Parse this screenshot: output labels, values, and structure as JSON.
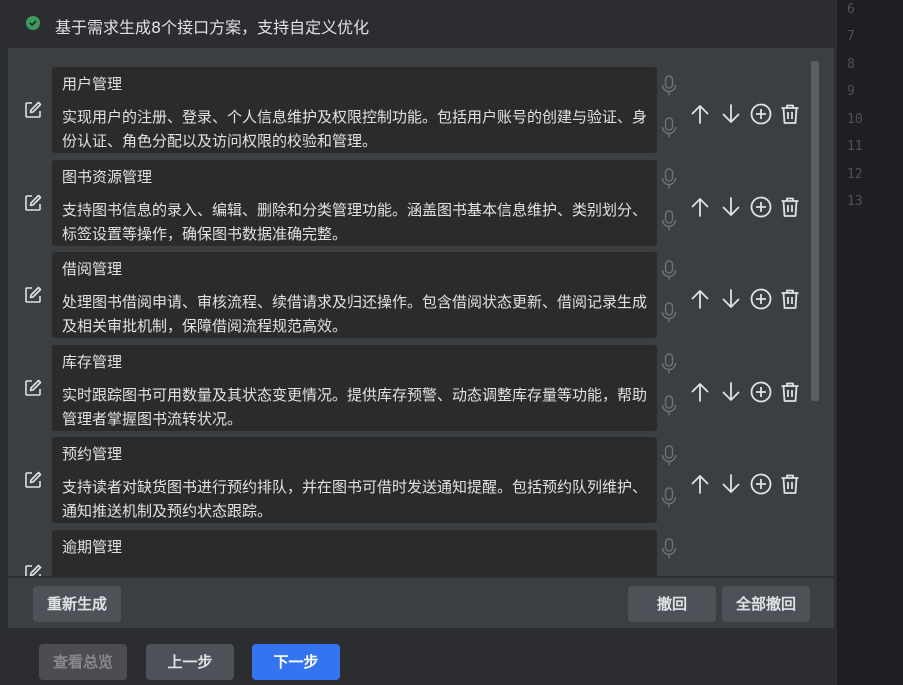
{
  "header": {
    "text": "基于需求生成8个接口方案，支持自定义优化"
  },
  "gutter": {
    "lines": [
      "6",
      "7",
      "8",
      "9",
      "10",
      "11",
      "12",
      "13"
    ]
  },
  "items": [
    {
      "title": "用户管理",
      "desc": "实现用户的注册、登录、个人信息维护及权限控制功能。包括用户账号的创建与验证、身份认证、角色分配以及访问权限的校验和管理。"
    },
    {
      "title": "图书资源管理",
      "desc": "支持图书信息的录入、编辑、删除和分类管理功能。涵盖图书基本信息维护、类别划分、标签设置等操作，确保图书数据准确完整。"
    },
    {
      "title": "借阅管理",
      "desc": "处理图书借阅申请、审核流程、续借请求及归还操作。包含借阅状态更新、借阅记录生成及相关审批机制，保障借阅流程规范高效。"
    },
    {
      "title": "库存管理",
      "desc": "实时跟踪图书可用数量及其状态变更情况。提供库存预警、动态调整库存量等功能，帮助管理者掌握图书流转状况。"
    },
    {
      "title": "预约管理",
      "desc": "支持读者对缺货图书进行预约排队，并在图书可借时发送通知提醒。包括预约队列维护、通知推送机制及预约状态跟踪。"
    },
    {
      "title": "逾期管理",
      "desc": ""
    }
  ],
  "actions": {
    "regen": "重新生成",
    "undo": "撤回",
    "undo_all": "全部撤回"
  },
  "footer": {
    "overview": "查看总览",
    "prev": "上一步",
    "next": "下一步"
  },
  "colors": {
    "accent": "#3574f0",
    "success": "#3d9a5f",
    "panel": "#3c3f41",
    "card": "#2b2b2b"
  },
  "icons": [
    "check-circle-icon",
    "edit-icon",
    "mic-icon",
    "arrow-up-icon",
    "arrow-down-icon",
    "plus-circle-icon",
    "trash-icon"
  ]
}
